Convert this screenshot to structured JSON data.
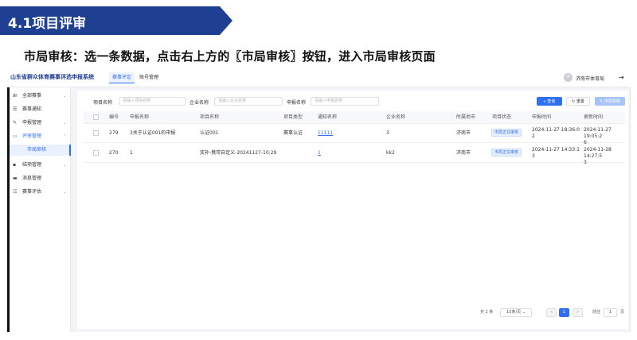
{
  "slide": {
    "section_title": "4.1项目评审",
    "instruction": "市局审核：选一条数据，点击右上方的〖市局审核〗按钮，进入市局审核页面"
  },
  "app": {
    "title": "山东省群众体育赛事评选申报系统",
    "top_tabs": [
      "赛事评定",
      "账号管理"
    ],
    "active_tab": 0,
    "user": {
      "avatar_text": "济",
      "name": "济南市体育局"
    }
  },
  "sidebar": {
    "items": [
      {
        "label": "全部赛事",
        "icon": "grid-icon",
        "glyph": "⊞",
        "arrow": "⌄"
      },
      {
        "label": "赛事通知",
        "icon": "bell-icon",
        "glyph": "☰",
        "arrow": ""
      },
      {
        "label": "申报管理",
        "icon": "edit-icon",
        "glyph": "✎",
        "arrow": "⌄"
      },
      {
        "label": "评审管理",
        "icon": "review-icon",
        "glyph": "▭",
        "arrow": "⌃"
      },
      {
        "label": "市局审核",
        "icon": "",
        "glyph": "",
        "arrow": ""
      },
      {
        "label": "结项管理",
        "icon": "folder-icon",
        "glyph": "▪",
        "arrow": "⌄"
      },
      {
        "label": "消息管理",
        "icon": "message-icon",
        "glyph": "▬",
        "arrow": ""
      },
      {
        "label": "赛事评估",
        "icon": "assess-icon",
        "glyph": "☷",
        "arrow": "⌄"
      }
    ]
  },
  "filters": {
    "project_name_label": "项目名称",
    "project_name_placeholder": "请输入项目名称",
    "company_name_label": "企业名称",
    "company_name_placeholder": "请输入企业名称",
    "applicant_label": "申报名称",
    "applicant_placeholder": "请输入申报名称",
    "search_label": "查询",
    "reset_label": "重置",
    "audit_label": "市局审核"
  },
  "table": {
    "columns": [
      "编号",
      "申报名称",
      "项目名称",
      "项目类型",
      "通知名称",
      "企业名称",
      "所属地市",
      "项目状态",
      "申报时间",
      "更新时间"
    ],
    "rows": [
      {
        "id": "279",
        "apply_name": "3关于认证001的申报",
        "project_name": "认证001",
        "project_type": "赛事认证",
        "notice_name": "11111",
        "company": "3",
        "city": "济南市",
        "status": "市局正在审核",
        "apply_time_1": "2024-11-27 18:36:0",
        "apply_time_2": "2",
        "update_time_1": "2024-11-27 19:05:2",
        "update_time_2": "6"
      },
      {
        "id": "270",
        "apply_name": "1",
        "project_name": "奖补-携带自定义-20241127-10:29",
        "project_type": "",
        "notice_name": "1",
        "company": "kk2",
        "city": "济南市",
        "status": "市局正在审核",
        "apply_time_1": "2024-11-27 14:33:1",
        "apply_time_2": "3",
        "update_time_1": "2024-11-28 14:27:5",
        "update_time_2": "3"
      }
    ]
  },
  "pagination": {
    "total": "共 2 条",
    "page_size": "15条/页",
    "prev": "<",
    "current": "1",
    "next": ">",
    "goto_label": "前往",
    "goto_value": "1",
    "page_unit": "页"
  },
  "colors": {
    "banner": "#1f3f93",
    "primary": "#2f6ff0"
  }
}
